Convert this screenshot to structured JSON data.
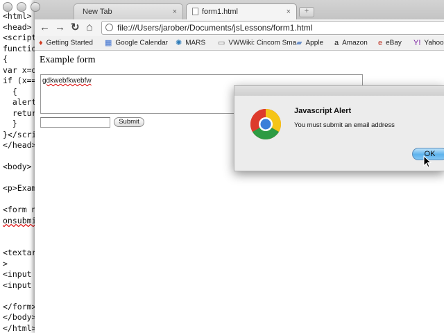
{
  "editor": {
    "lines": [
      {
        "text": "<html>",
        "squiggle": false
      },
      {
        "text": "<head>",
        "squiggle": false
      },
      {
        "text": "<script",
        "squiggle": false
      },
      {
        "text": "functio",
        "squiggle": false
      },
      {
        "text": "{",
        "squiggle": false
      },
      {
        "text": "var x=d",
        "squiggle": false
      },
      {
        "text": "if (x==",
        "squiggle": false
      },
      {
        "text": "  {",
        "squiggle": false
      },
      {
        "text": "  alert",
        "squiggle": false
      },
      {
        "text": "  retur",
        "squiggle": false
      },
      {
        "text": "  }",
        "squiggle": false
      },
      {
        "text": "}</scri",
        "squiggle": false
      },
      {
        "text": "</head>",
        "squiggle": false
      },
      {
        "text": "",
        "squiggle": false
      },
      {
        "text": "<body>",
        "squiggle": false
      },
      {
        "text": "",
        "squiggle": false
      },
      {
        "text": "<p>Exam",
        "squiggle": false
      },
      {
        "text": "",
        "squiggle": false
      },
      {
        "text": "<form n",
        "squiggle": false
      },
      {
        "text": "onsubmi",
        "squiggle": true
      },
      {
        "text": "",
        "squiggle": false
      },
      {
        "text": "",
        "squiggle": false
      },
      {
        "text": "<textar",
        "squiggle": false
      },
      {
        "text": ">",
        "squiggle": false
      },
      {
        "text": "<input",
        "squiggle": false
      },
      {
        "text": "<input",
        "squiggle": false
      },
      {
        "text": "",
        "squiggle": false
      },
      {
        "text": "</form>",
        "squiggle": false
      },
      {
        "text": "</body>",
        "squiggle": false
      },
      {
        "text": "</html>",
        "squiggle": false
      }
    ]
  },
  "browser": {
    "tabs": [
      {
        "label": "New Tab",
        "close": "×"
      },
      {
        "label": "form1.html",
        "close": "×"
      }
    ],
    "new_tab": "+",
    "nav": {
      "back": "←",
      "forward": "→",
      "reload": "↻",
      "home": "⌂"
    },
    "url": "file:///Users/jarober/Documents/jsLessons/form1.html",
    "bookmarks": [
      {
        "label": "Getting Started",
        "icon": "♦",
        "color": "#d03a20"
      },
      {
        "label": "Google Calendar",
        "icon": "▦",
        "color": "#3a6fd0"
      },
      {
        "label": "MARS",
        "icon": "✺",
        "color": "#2a7ab8"
      },
      {
        "label": "VWWiki: Cincom Sma",
        "icon": "▭",
        "color": "#666666"
      },
      {
        "label": "Apple",
        "icon": "▰",
        "color": "#6a8fc8"
      },
      {
        "label": "Amazon",
        "icon": "a",
        "color": "#222222"
      },
      {
        "label": "eBay",
        "icon": "e",
        "color": "#c0392b"
      },
      {
        "label": "Yahoo!",
        "icon": "Y!",
        "color": "#7b1fa2"
      }
    ]
  },
  "page": {
    "heading": "Example form",
    "textarea_value": "gdkwebfkwebfw",
    "email_value": "",
    "submit_label": "Submit"
  },
  "alert": {
    "title": "Javascript Alert",
    "message": "You must submit an email address",
    "ok_label": "OK"
  }
}
